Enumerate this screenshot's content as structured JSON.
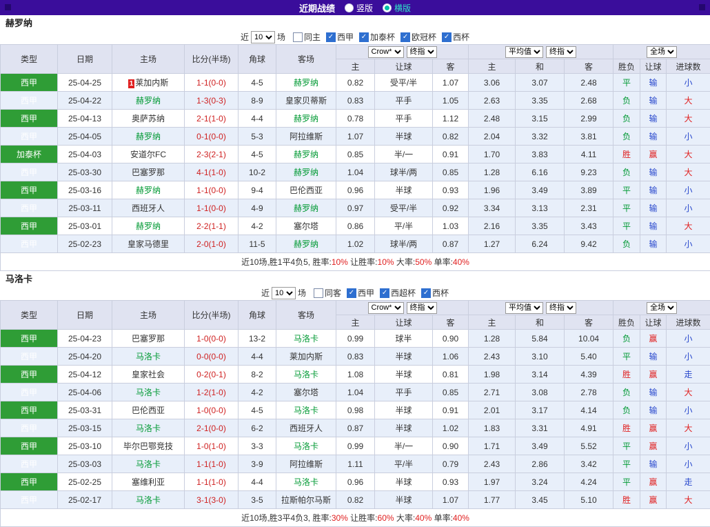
{
  "topbar": {
    "title": "近期战绩",
    "radios": [
      {
        "label": "竖版",
        "selected": false
      },
      {
        "label": "横版",
        "selected": true
      }
    ]
  },
  "colors": {
    "topbar_bg": "#3a0d9b",
    "header_bg": "#e0e3f1",
    "row_alt_bg": "#e8effa",
    "league_bg": "#2f9d36",
    "focus_team": "#009933",
    "score": "#cf2020",
    "checkbox_checked": "#2e6fd0",
    "radio_selected": "#00bfa8",
    "result_map": {
      "胜": "#e02020",
      "赢": "#e02020",
      "大": "#e02020",
      "平": "#009933",
      "负": "#009933",
      "输": "#2747cc",
      "小": "#2747cc",
      "走": "#2747cc"
    }
  },
  "sections": [
    {
      "team": "赫罗纳",
      "filter": {
        "near_label": "近",
        "count": "10",
        "games_label": "场",
        "checkboxes": [
          {
            "label": "同主",
            "checked": false
          },
          {
            "label": "西甲",
            "checked": true
          },
          {
            "label": "加泰杯",
            "checked": true
          },
          {
            "label": "欧冠杯",
            "checked": true
          },
          {
            "label": "西杯",
            "checked": true
          }
        ]
      },
      "header": {
        "main_cols": [
          "类型",
          "日期",
          "主场",
          "比分(半场)",
          "角球",
          "客场"
        ],
        "groups": [
          {
            "selects": [
              "Crow*",
              "终指"
            ],
            "cols": [
              "主",
              "让球",
              "客"
            ]
          },
          {
            "selects": [
              "平均值",
              "终指"
            ],
            "cols": [
              "主",
              "和",
              "客"
            ]
          },
          {
            "selects": [
              "全场"
            ],
            "cols": [
              "胜负",
              "让球",
              "进球数"
            ]
          }
        ]
      },
      "rows": [
        {
          "league": "西甲",
          "date": "25-04-25",
          "home": "莱加内斯",
          "home_badge": "1",
          "home_focus": false,
          "score": "1-1(0-0)",
          "corners": "4-5",
          "away": "赫罗纳",
          "away_focus": true,
          "odds": [
            "0.82",
            "受平/半",
            "1.07"
          ],
          "avg": [
            "3.06",
            "3.07",
            "2.48"
          ],
          "results": [
            "平",
            "输",
            "小"
          ]
        },
        {
          "league": "西甲",
          "date": "25-04-22",
          "home": "赫罗纳",
          "home_focus": true,
          "score": "1-3(0-3)",
          "corners": "8-9",
          "away": "皇家贝蒂斯",
          "away_focus": false,
          "odds": [
            "0.83",
            "平手",
            "1.05"
          ],
          "avg": [
            "2.63",
            "3.35",
            "2.68"
          ],
          "results": [
            "负",
            "输",
            "大"
          ]
        },
        {
          "league": "西甲",
          "date": "25-04-13",
          "home": "奥萨苏纳",
          "home_focus": false,
          "score": "2-1(1-0)",
          "corners": "4-4",
          "away": "赫罗纳",
          "away_focus": true,
          "odds": [
            "0.78",
            "平手",
            "1.12"
          ],
          "avg": [
            "2.48",
            "3.15",
            "2.99"
          ],
          "results": [
            "负",
            "输",
            "大"
          ]
        },
        {
          "league": "西甲",
          "date": "25-04-05",
          "home": "赫罗纳",
          "home_focus": true,
          "score": "0-1(0-0)",
          "corners": "5-3",
          "away": "阿拉维斯",
          "away_focus": false,
          "odds": [
            "1.07",
            "半球",
            "0.82"
          ],
          "avg": [
            "2.04",
            "3.32",
            "3.81"
          ],
          "results": [
            "负",
            "输",
            "小"
          ]
        },
        {
          "league": "加泰杯",
          "date": "25-04-03",
          "home": "安道尔FC",
          "home_focus": false,
          "score": "2-3(2-1)",
          "corners": "4-5",
          "away": "赫罗纳",
          "away_focus": true,
          "odds": [
            "0.85",
            "半/一",
            "0.91"
          ],
          "avg": [
            "1.70",
            "3.83",
            "4.11"
          ],
          "results": [
            "胜",
            "赢",
            "大"
          ]
        },
        {
          "league": "西甲",
          "date": "25-03-30",
          "home": "巴塞罗那",
          "home_focus": false,
          "score": "4-1(1-0)",
          "corners": "10-2",
          "away": "赫罗纳",
          "away_focus": true,
          "odds": [
            "1.04",
            "球半/两",
            "0.85"
          ],
          "avg": [
            "1.28",
            "6.16",
            "9.23"
          ],
          "results": [
            "负",
            "输",
            "大"
          ]
        },
        {
          "league": "西甲",
          "date": "25-03-16",
          "home": "赫罗纳",
          "home_focus": true,
          "score": "1-1(0-0)",
          "corners": "9-4",
          "away": "巴伦西亚",
          "away_focus": false,
          "odds": [
            "0.96",
            "半球",
            "0.93"
          ],
          "avg": [
            "1.96",
            "3.49",
            "3.89"
          ],
          "results": [
            "平",
            "输",
            "小"
          ]
        },
        {
          "league": "西甲",
          "date": "25-03-11",
          "home": "西班牙人",
          "home_focus": false,
          "score": "1-1(0-0)",
          "corners": "4-9",
          "away": "赫罗纳",
          "away_focus": true,
          "odds": [
            "0.97",
            "受平/半",
            "0.92"
          ],
          "avg": [
            "3.34",
            "3.13",
            "2.31"
          ],
          "results": [
            "平",
            "输",
            "小"
          ]
        },
        {
          "league": "西甲",
          "date": "25-03-01",
          "home": "赫罗纳",
          "home_focus": true,
          "score": "2-2(1-1)",
          "corners": "4-2",
          "away": "塞尔塔",
          "away_focus": false,
          "odds": [
            "0.86",
            "平/半",
            "1.03"
          ],
          "avg": [
            "2.16",
            "3.35",
            "3.43"
          ],
          "results": [
            "平",
            "输",
            "大"
          ]
        },
        {
          "league": "西甲",
          "date": "25-02-23",
          "home": "皇家马德里",
          "home_focus": false,
          "score": "2-0(1-0)",
          "corners": "11-5",
          "away": "赫罗纳",
          "away_focus": true,
          "odds": [
            "1.02",
            "球半/两",
            "0.87"
          ],
          "avg": [
            "1.27",
            "6.24",
            "9.42"
          ],
          "results": [
            "负",
            "输",
            "小"
          ]
        }
      ],
      "summary": [
        {
          "text": "近10场,胜1平4负5, ",
          "color": "#333333"
        },
        {
          "text": "胜率:",
          "color": "#333333"
        },
        {
          "text": "10%",
          "color": "#e02020"
        },
        {
          "text": " 让胜率:",
          "color": "#333333"
        },
        {
          "text": "10%",
          "color": "#e02020"
        },
        {
          "text": " 大率:",
          "color": "#333333"
        },
        {
          "text": "50%",
          "color": "#e02020"
        },
        {
          "text": " 单率:",
          "color": "#333333"
        },
        {
          "text": "40%",
          "color": "#e02020"
        }
      ]
    },
    {
      "team": "马洛卡",
      "filter": {
        "near_label": "近",
        "count": "10",
        "games_label": "场",
        "checkboxes": [
          {
            "label": "同客",
            "checked": false
          },
          {
            "label": "西甲",
            "checked": true
          },
          {
            "label": "西超杯",
            "checked": true
          },
          {
            "label": "西杯",
            "checked": true
          }
        ]
      },
      "header": {
        "main_cols": [
          "类型",
          "日期",
          "主场",
          "比分(半场)",
          "角球",
          "客场"
        ],
        "groups": [
          {
            "selects": [
              "Crow*",
              "终指"
            ],
            "cols": [
              "主",
              "让球",
              "客"
            ]
          },
          {
            "selects": [
              "平均值",
              "终指"
            ],
            "cols": [
              "主",
              "和",
              "客"
            ]
          },
          {
            "selects": [
              "全场"
            ],
            "cols": [
              "胜负",
              "让球",
              "进球数"
            ]
          }
        ]
      },
      "rows": [
        {
          "league": "西甲",
          "date": "25-04-23",
          "home": "巴塞罗那",
          "home_focus": false,
          "score": "1-0(0-0)",
          "corners": "13-2",
          "away": "马洛卡",
          "away_focus": true,
          "odds": [
            "0.99",
            "球半",
            "0.90"
          ],
          "avg": [
            "1.28",
            "5.84",
            "10.04"
          ],
          "results": [
            "负",
            "赢",
            "小"
          ]
        },
        {
          "league": "西甲",
          "date": "25-04-20",
          "home": "马洛卡",
          "home_focus": true,
          "score": "0-0(0-0)",
          "corners": "4-4",
          "away": "莱加内斯",
          "away_focus": false,
          "odds": [
            "0.83",
            "半球",
            "1.06"
          ],
          "avg": [
            "2.43",
            "3.10",
            "5.40"
          ],
          "results": [
            "平",
            "输",
            "小"
          ]
        },
        {
          "league": "西甲",
          "date": "25-04-12",
          "home": "皇家社会",
          "home_focus": false,
          "score": "0-2(0-1)",
          "corners": "8-2",
          "away": "马洛卡",
          "away_focus": true,
          "odds": [
            "1.08",
            "半球",
            "0.81"
          ],
          "avg": [
            "1.98",
            "3.14",
            "4.39"
          ],
          "results": [
            "胜",
            "赢",
            "走"
          ]
        },
        {
          "league": "西甲",
          "date": "25-04-06",
          "home": "马洛卡",
          "home_focus": true,
          "score": "1-2(1-0)",
          "corners": "4-2",
          "away": "塞尔塔",
          "away_focus": false,
          "odds": [
            "1.04",
            "平手",
            "0.85"
          ],
          "avg": [
            "2.71",
            "3.08",
            "2.78"
          ],
          "results": [
            "负",
            "输",
            "大"
          ]
        },
        {
          "league": "西甲",
          "date": "25-03-31",
          "home": "巴伦西亚",
          "home_focus": false,
          "score": "1-0(0-0)",
          "corners": "4-5",
          "away": "马洛卡",
          "away_focus": true,
          "odds": [
            "0.98",
            "半球",
            "0.91"
          ],
          "avg": [
            "2.01",
            "3.17",
            "4.14"
          ],
          "results": [
            "负",
            "输",
            "小"
          ]
        },
        {
          "league": "西甲",
          "date": "25-03-15",
          "home": "马洛卡",
          "home_focus": true,
          "score": "2-1(0-0)",
          "corners": "6-2",
          "away": "西班牙人",
          "away_focus": false,
          "odds": [
            "0.87",
            "半球",
            "1.02"
          ],
          "avg": [
            "1.83",
            "3.31",
            "4.91"
          ],
          "results": [
            "胜",
            "赢",
            "大"
          ]
        },
        {
          "league": "西甲",
          "date": "25-03-10",
          "home": "毕尔巴鄂竞技",
          "home_focus": false,
          "score": "1-0(1-0)",
          "corners": "3-3",
          "away": "马洛卡",
          "away_focus": true,
          "odds": [
            "0.99",
            "半/一",
            "0.90"
          ],
          "avg": [
            "1.71",
            "3.49",
            "5.52"
          ],
          "results": [
            "平",
            "赢",
            "小"
          ]
        },
        {
          "league": "西甲",
          "date": "25-03-03",
          "home": "马洛卡",
          "home_focus": true,
          "score": "1-1(1-0)",
          "corners": "3-9",
          "away": "阿拉维斯",
          "away_focus": false,
          "odds": [
            "1.11",
            "平/半",
            "0.79"
          ],
          "avg": [
            "2.43",
            "2.86",
            "3.42"
          ],
          "results": [
            "平",
            "输",
            "小"
          ]
        },
        {
          "league": "西甲",
          "date": "25-02-25",
          "home": "塞维利亚",
          "home_focus": false,
          "score": "1-1(1-0)",
          "corners": "4-4",
          "away": "马洛卡",
          "away_focus": true,
          "odds": [
            "0.96",
            "半球",
            "0.93"
          ],
          "avg": [
            "1.97",
            "3.24",
            "4.24"
          ],
          "results": [
            "平",
            "赢",
            "走"
          ]
        },
        {
          "league": "西甲",
          "date": "25-02-17",
          "home": "马洛卡",
          "home_focus": true,
          "score": "3-1(3-0)",
          "corners": "3-5",
          "away": "拉斯帕尔马斯",
          "away_focus": false,
          "odds": [
            "0.82",
            "半球",
            "1.07"
          ],
          "avg": [
            "1.77",
            "3.45",
            "5.10"
          ],
          "results": [
            "胜",
            "赢",
            "大"
          ]
        }
      ],
      "summary": [
        {
          "text": "近10场,胜3平4负3, ",
          "color": "#333333"
        },
        {
          "text": "胜率:",
          "color": "#333333"
        },
        {
          "text": "30%",
          "color": "#e02020"
        },
        {
          "text": " 让胜率:",
          "color": "#333333"
        },
        {
          "text": "60%",
          "color": "#e02020"
        },
        {
          "text": " 大率:",
          "color": "#333333"
        },
        {
          "text": "40%",
          "color": "#e02020"
        },
        {
          "text": " 单率:",
          "color": "#333333"
        },
        {
          "text": "40%",
          "color": "#e02020"
        }
      ]
    }
  ]
}
